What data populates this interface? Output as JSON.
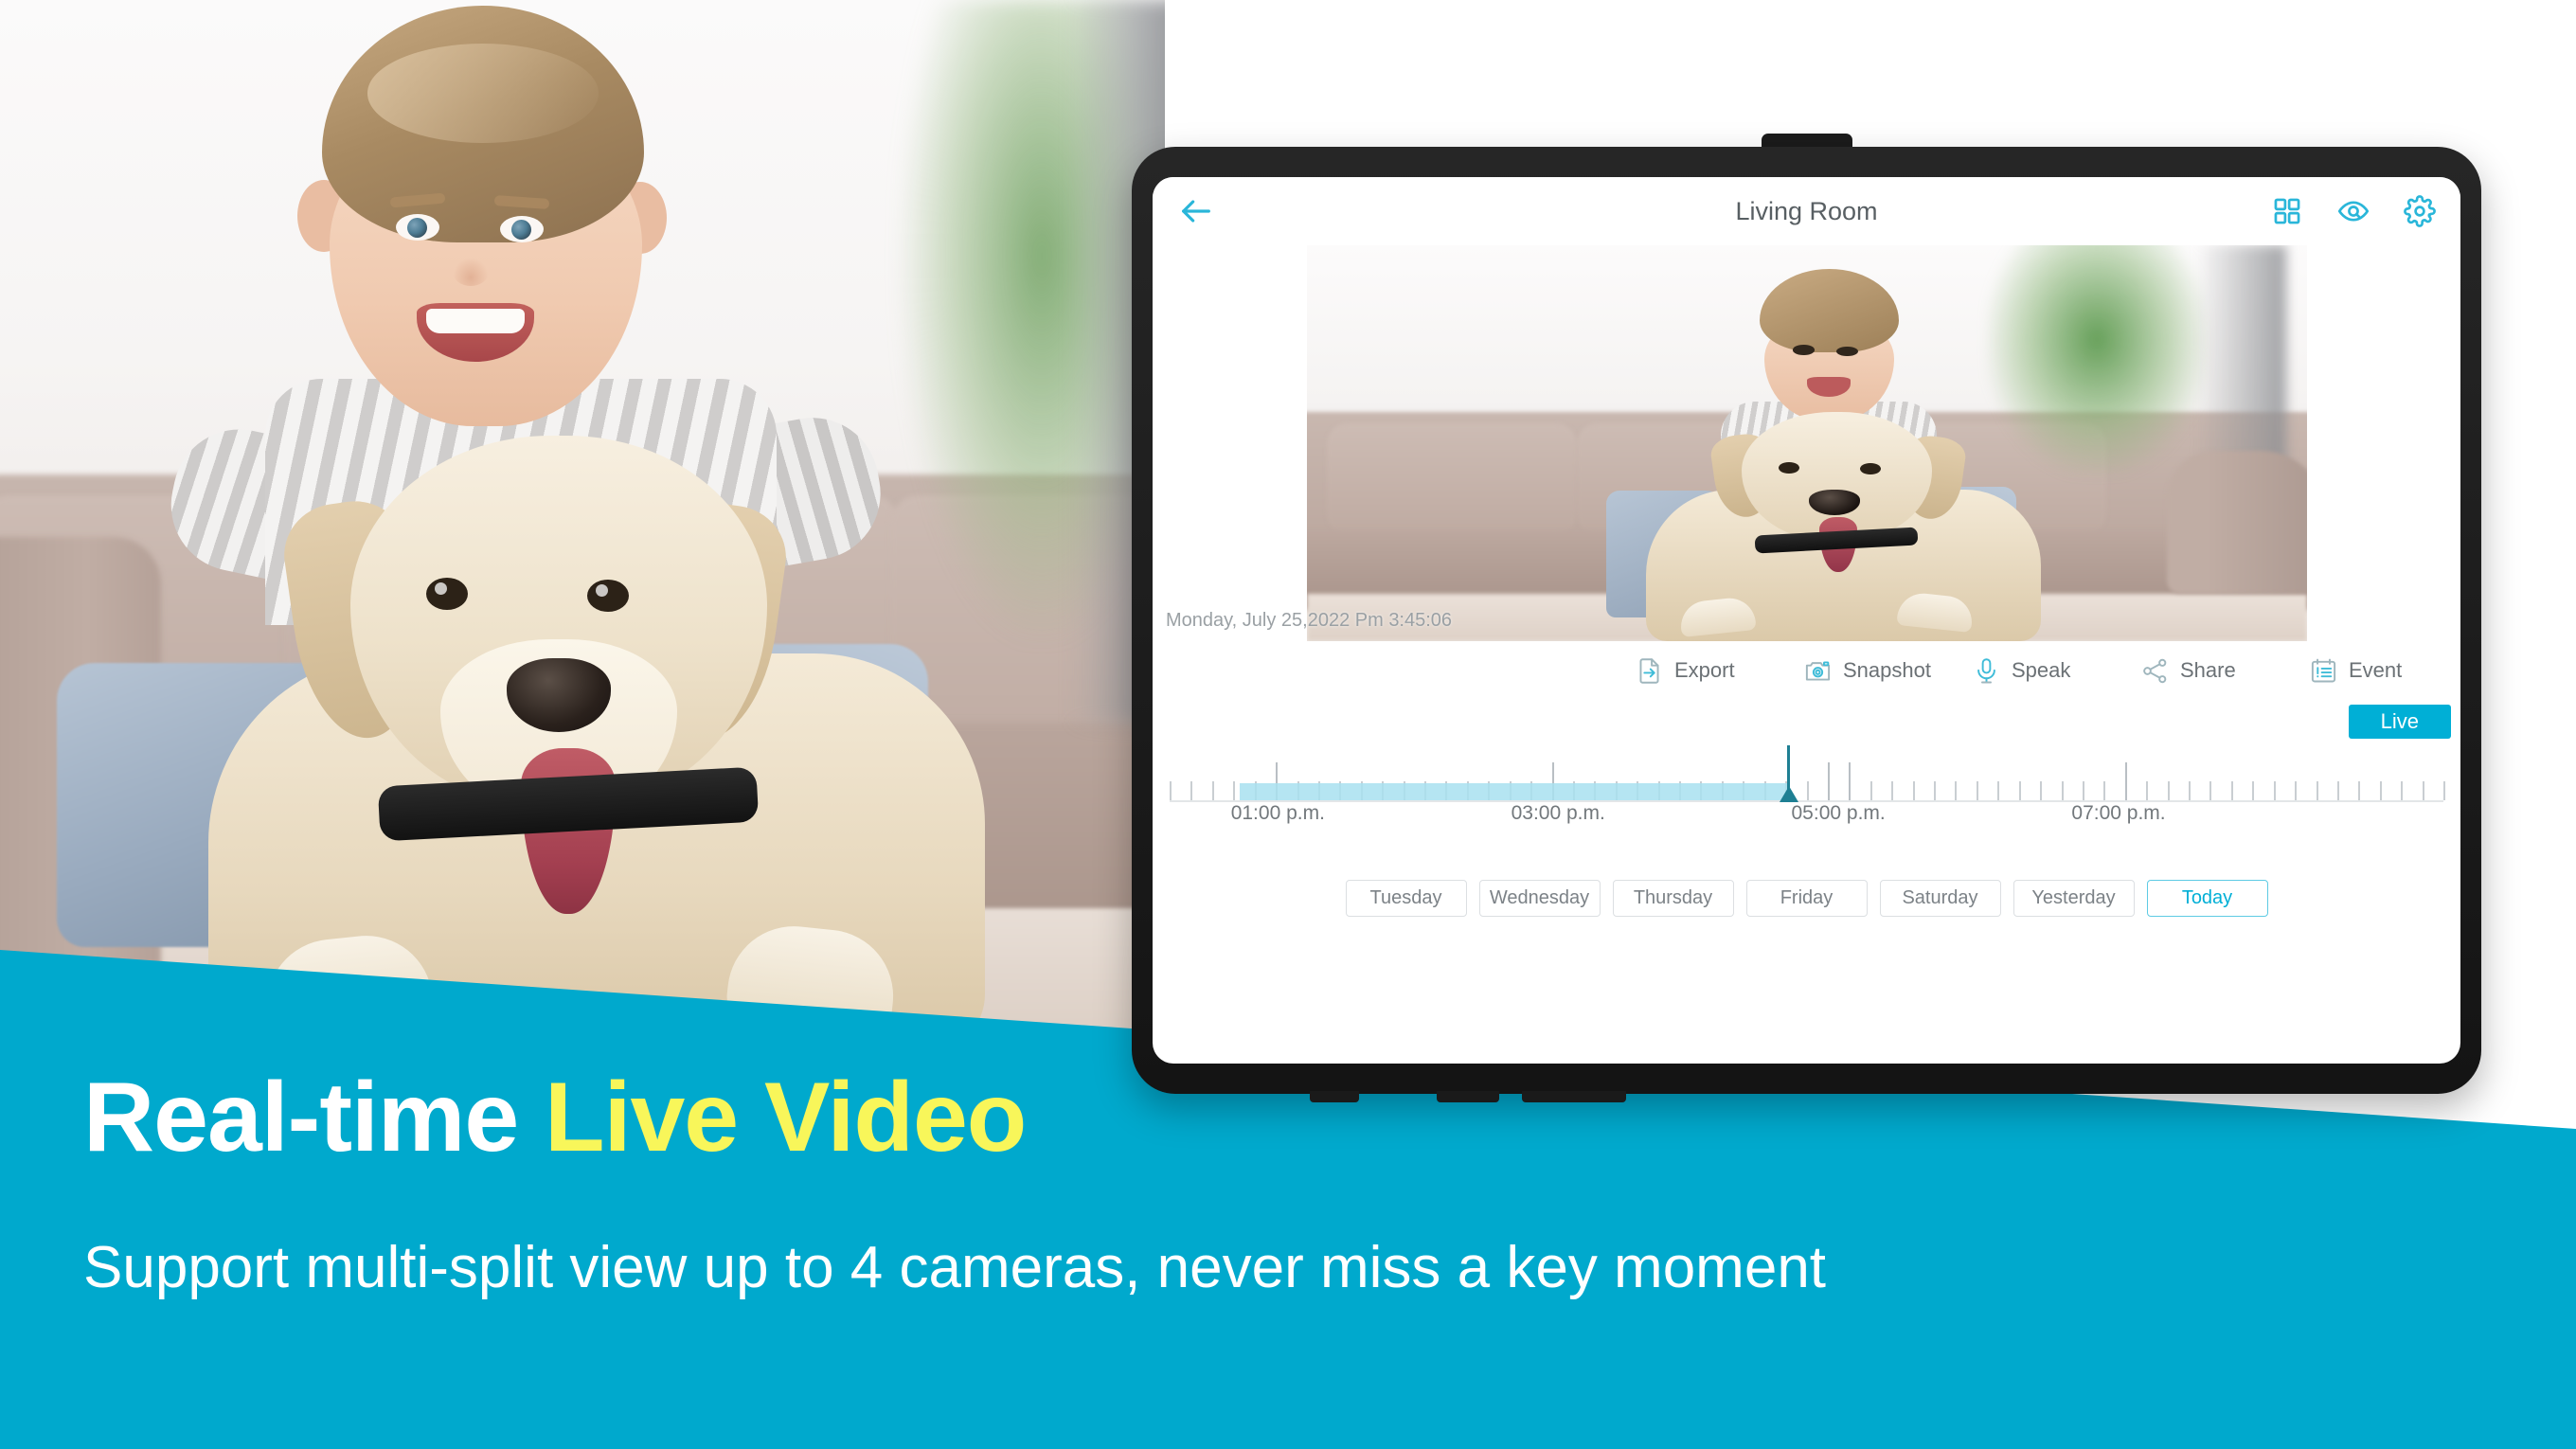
{
  "banner": {
    "headline_part1": "Real-time ",
    "headline_part2": "Live Video",
    "subhead": "Support multi-split view up to 4 cameras, never miss a key moment",
    "bg_color": "#00a9cd",
    "headline_highlight_color": "#f8f65a"
  },
  "app": {
    "header": {
      "back_label": "Back",
      "title": "Living Room",
      "icons": [
        {
          "name": "grid-view-icon",
          "label": "Multi-split view"
        },
        {
          "name": "privacy-eye-icon",
          "label": "Privacy mode"
        },
        {
          "name": "settings-gear-icon",
          "label": "Settings"
        }
      ],
      "icon_color": "#2ab6d9"
    },
    "video": {
      "timestamp": "Monday, July 25,2022 Pm 3:45:06"
    },
    "toolbar": {
      "items": [
        {
          "label": "Export",
          "icon": "export-icon"
        },
        {
          "label": "Snapshot",
          "icon": "snapshot-camera-icon"
        },
        {
          "label": "Speak",
          "icon": "speak-microphone-icon"
        },
        {
          "label": "Share",
          "icon": "share-icon"
        },
        {
          "label": "Event",
          "icon": "event-list-icon"
        }
      ]
    },
    "live_button": {
      "label": "Live",
      "color": "#00afd6"
    },
    "timeline": {
      "labels": [
        {
          "text": "01:00 p.m.",
          "pos_pct": 8.5
        },
        {
          "text": "03:00 p.m.",
          "pos_pct": 30.5
        },
        {
          "text": "05:00 p.m.",
          "pos_pct": 52.5
        },
        {
          "text": "07:00 p.m.",
          "pos_pct": 74.5
        }
      ],
      "recorded_start_pct": 5.5,
      "recorded_end_pct": 48.5,
      "playhead_pct": 48.5,
      "recorded_color": "#a8e0f0",
      "playhead_color": "#1e7f93"
    },
    "days": [
      {
        "label": "Tuesday",
        "active": false
      },
      {
        "label": "Wednesday",
        "active": false
      },
      {
        "label": "Thursday",
        "active": false
      },
      {
        "label": "Friday",
        "active": false
      },
      {
        "label": "Saturday",
        "active": false
      },
      {
        "label": "Yesterday",
        "active": false
      },
      {
        "label": "Today",
        "active": true
      }
    ]
  }
}
